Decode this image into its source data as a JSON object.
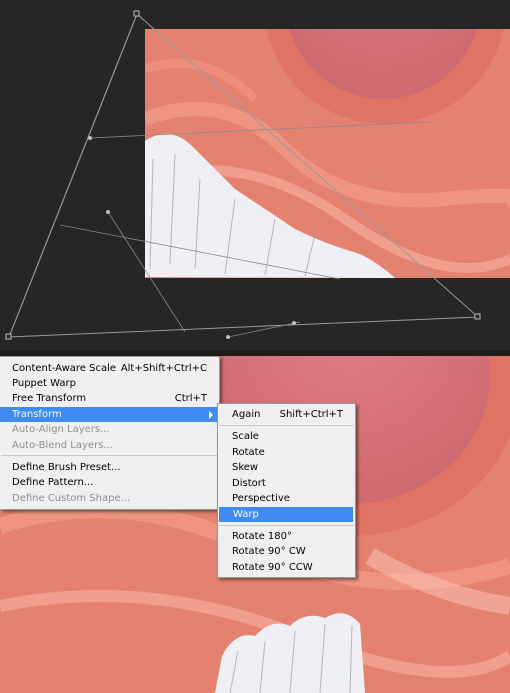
{
  "colors": {
    "canvas_bg": "#262626",
    "photo_base": "#e47f73",
    "sky": "#d9707a",
    "snow_trees": "#f2f4f8",
    "menu_bg": "#f0f0f0",
    "highlight": "#3f8bf2",
    "disabled_text": "#8e8e8e"
  },
  "edit_menu": {
    "items": [
      {
        "label": "Content-Aware Scale",
        "shortcut": "Alt+Shift+Ctrl+C",
        "enabled": true
      },
      {
        "label": "Puppet Warp",
        "shortcut": "",
        "enabled": true
      },
      {
        "label": "Free Transform",
        "shortcut": "Ctrl+T",
        "enabled": true
      },
      {
        "label": "Transform",
        "shortcut": "",
        "enabled": true,
        "highlighted": true,
        "submenu_icon": "submenu-arrow-icon"
      },
      {
        "label": "Auto-Align Layers...",
        "shortcut": "",
        "enabled": false
      },
      {
        "label": "Auto-Blend Layers...",
        "shortcut": "",
        "enabled": false
      },
      {
        "label": "Define Brush Preset...",
        "shortcut": "",
        "enabled": true
      },
      {
        "label": "Define Pattern...",
        "shortcut": "",
        "enabled": true
      },
      {
        "label": "Define Custom Shape...",
        "shortcut": "",
        "enabled": false
      }
    ]
  },
  "transform_submenu": {
    "items": [
      {
        "label": "Again",
        "shortcut": "Shift+Ctrl+T"
      },
      {
        "label": "Scale",
        "shortcut": ""
      },
      {
        "label": "Rotate",
        "shortcut": ""
      },
      {
        "label": "Skew",
        "shortcut": ""
      },
      {
        "label": "Distort",
        "shortcut": ""
      },
      {
        "label": "Perspective",
        "shortcut": ""
      },
      {
        "label": "Warp",
        "shortcut": "",
        "highlighted": true
      },
      {
        "label": "Rotate 180°",
        "shortcut": ""
      },
      {
        "label": "Rotate 90° CW",
        "shortcut": ""
      },
      {
        "label": "Rotate 90° CCW",
        "shortcut": ""
      }
    ]
  }
}
